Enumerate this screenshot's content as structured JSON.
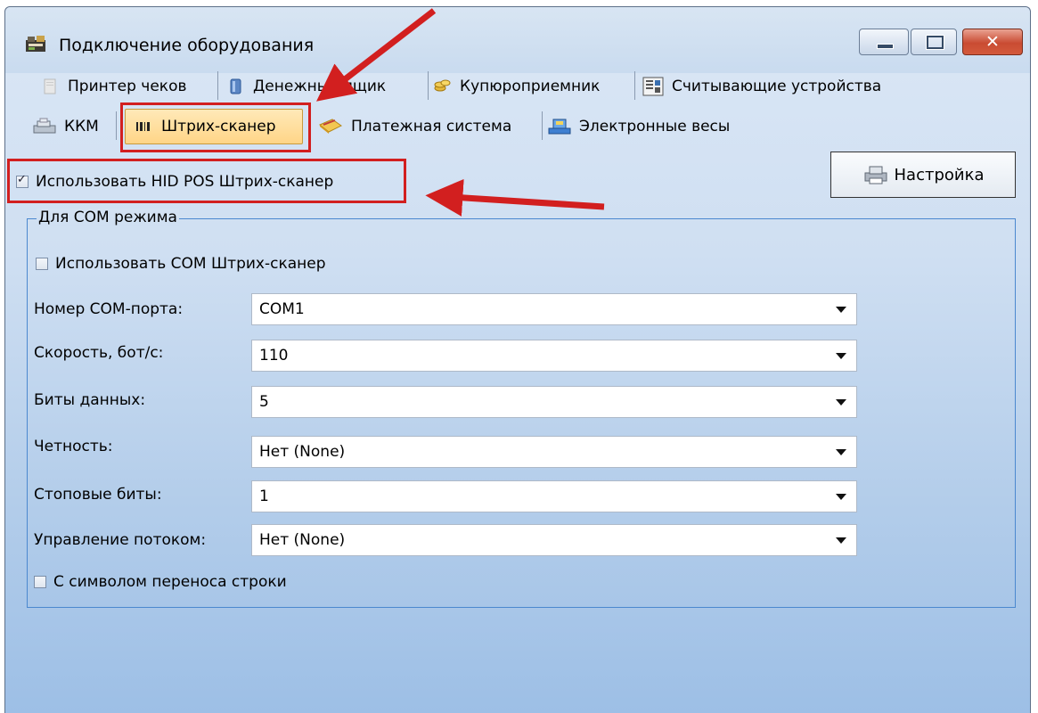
{
  "window": {
    "title": "Подключение оборудования",
    "close_label": "✕"
  },
  "tabs_row1": [
    {
      "label": "Принтер чеков",
      "icon": "printer-icon"
    },
    {
      "label": "Денежный ящик",
      "icon": "cash-drawer-icon"
    },
    {
      "label": "Купюроприемник",
      "icon": "coins-icon"
    },
    {
      "label": "Считывающие устройства",
      "icon": "reader-icon"
    }
  ],
  "tabs_row2": [
    {
      "label": "ККМ",
      "icon": "cash-register-icon",
      "active": false
    },
    {
      "label": "Штрих-сканер",
      "icon": "barcode-icon",
      "active": true
    },
    {
      "label": "Платежная система",
      "icon": "card-icon",
      "active": false
    },
    {
      "label": "Электронные весы",
      "icon": "scales-icon",
      "active": false
    }
  ],
  "hid": {
    "label": "Использовать HID POS Штрих-сканер",
    "checked": true
  },
  "settings_button": {
    "label": "Настройка"
  },
  "com_group": {
    "title": "Для COM режима",
    "use_com": {
      "label": "Использовать COM Штрих-сканер",
      "checked": false
    },
    "fields": [
      {
        "label": "Номер COM-порта:",
        "value": "COM1"
      },
      {
        "label": "Скорость, бот/с:",
        "value": "110"
      },
      {
        "label": "Биты данных:",
        "value": "5"
      },
      {
        "label": "Четность:",
        "value": "Нет (None)"
      },
      {
        "label": "Стоповые биты:",
        "value": "1"
      },
      {
        "label": "Управление потоком:",
        "value": "Нет (None)"
      }
    ],
    "newline": {
      "label": "С символом переноса строки",
      "checked": false
    }
  },
  "colors": {
    "highlight": "#d21f1f",
    "active_tab": "#ffd587",
    "group_border": "#4b88cf"
  }
}
